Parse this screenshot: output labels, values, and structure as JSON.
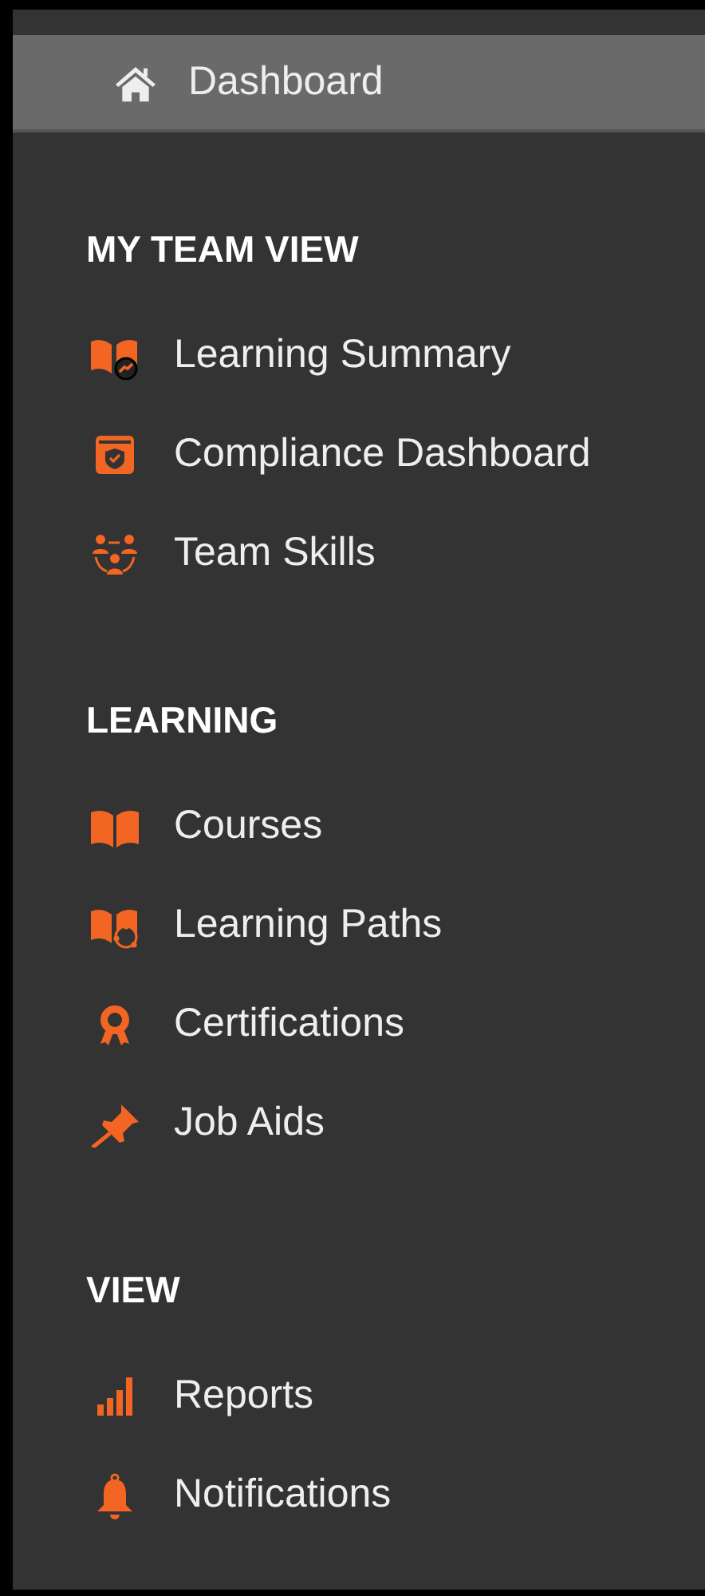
{
  "dashboard": {
    "label": "Dashboard",
    "selected": true
  },
  "sections": [
    {
      "title": "MY TEAM VIEW",
      "items": [
        {
          "label": "Learning Summary",
          "kind": "book-chart"
        },
        {
          "label": "Compliance Dashboard",
          "kind": "browser-shield"
        },
        {
          "label": "Team Skills",
          "kind": "team"
        }
      ]
    },
    {
      "title": "LEARNING",
      "items": [
        {
          "label": "Courses",
          "kind": "book"
        },
        {
          "label": "Learning Paths",
          "kind": "book-path"
        },
        {
          "label": "Certifications",
          "kind": "award"
        },
        {
          "label": "Job Aids",
          "kind": "pin"
        }
      ]
    },
    {
      "title": "VIEW",
      "items": [
        {
          "label": "Reports",
          "kind": "bars"
        },
        {
          "label": "Notifications",
          "kind": "bell"
        }
      ]
    }
  ]
}
